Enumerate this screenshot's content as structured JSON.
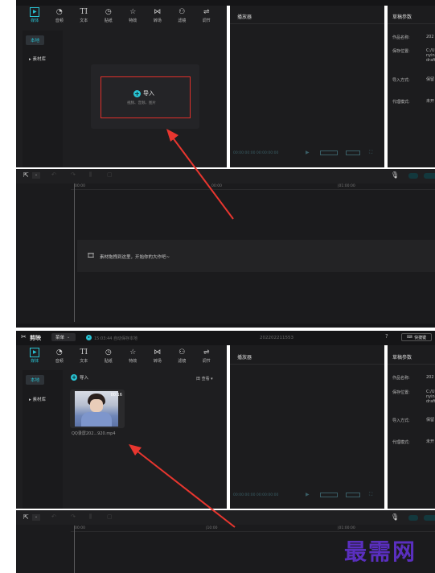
{
  "toolbar": {
    "items": [
      {
        "label": "媒体",
        "icon": "media-icon"
      },
      {
        "label": "音频",
        "icon": "audio-icon"
      },
      {
        "label": "文本",
        "icon": "text-icon",
        "glyph": "TI"
      },
      {
        "label": "贴纸",
        "icon": "sticker-icon"
      },
      {
        "label": "特效",
        "icon": "effects-icon"
      },
      {
        "label": "转场",
        "icon": "transition-icon"
      },
      {
        "label": "滤镜",
        "icon": "filter-icon"
      },
      {
        "label": "调节",
        "icon": "adjust-icon"
      }
    ]
  },
  "sidebar": {
    "local": "本地",
    "library": "▸ 素材库"
  },
  "player": {
    "title": "播放器"
  },
  "draft": {
    "title": "草稿参数",
    "fields": [
      {
        "key": "作品名称:",
        "value": "202"
      },
      {
        "key": "保存位置:",
        "value": "C:/U nyin drafi"
      },
      {
        "key": "导入方式:",
        "value": "保留"
      },
      {
        "key": "代理模式:",
        "value": "未开"
      }
    ]
  },
  "panel1": {
    "import_label": "导入",
    "import_hint": "视频、音频、图片",
    "timeline_hint": "素材拖拽到这里，开始你的大作吧~",
    "ruler": [
      "00:00",
      "00:00",
      "|01:00:00"
    ],
    "player_time": "00:00:00:00  00:00:00:00"
  },
  "panel2": {
    "app_name": "剪映",
    "menu_label": "菜单",
    "autosave": "15:03:44 自动保存本地",
    "project_title": "202202211553",
    "shortcut_label": "快捷键",
    "import_label": "导入",
    "view_label": "田 查看 ▾",
    "clip_name": "QQ录屏202...920.mp4",
    "clip_duration": "00:16",
    "ruler": [
      "00:00",
      "|10:00",
      "|01:00:00"
    ],
    "player_time": "00:00:00:00  00:00:00:00"
  },
  "watermark": "最需网",
  "colors": {
    "accent": "#29c3d3",
    "highlight_box": "#e0302b",
    "arrow": "#e8362f",
    "watermark": "#5a2fbf",
    "panel_bg": "#1c1c1e"
  }
}
